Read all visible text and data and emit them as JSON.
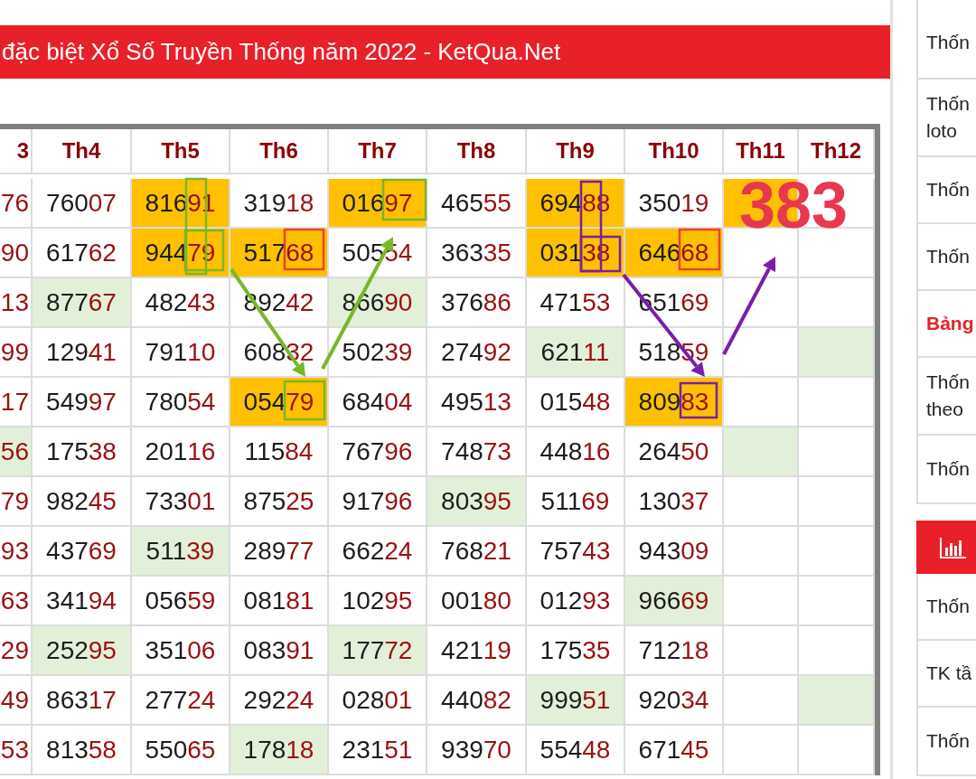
{
  "banner": {
    "title": "đặc biệt Xổ Số Truyền Thống năm 2022 - KetQua.Net"
  },
  "table": {
    "columns": [
      "3",
      "Th4",
      "Th5",
      "Th6",
      "Th7",
      "Th8",
      "Th9",
      "Th10",
      "Th11",
      "Th12"
    ],
    "rows": [
      {
        "cells": [
          {
            "value": "76",
            "kind": "plain"
          },
          {
            "value": "76007",
            "kind": "plain"
          },
          {
            "value": "81691",
            "kind": "gold"
          },
          {
            "value": "31918",
            "kind": "plain"
          },
          {
            "value": "01697",
            "kind": "gold"
          },
          {
            "value": "46555",
            "kind": "plain"
          },
          {
            "value": "69488",
            "kind": "gold"
          },
          {
            "value": "35019",
            "kind": "plain"
          },
          {
            "kind": "gold"
          },
          {
            "kind": "plain"
          }
        ]
      },
      {
        "cells": [
          {
            "value": "90",
            "kind": "plain"
          },
          {
            "value": "61762",
            "kind": "plain"
          },
          {
            "value": "94479",
            "kind": "gold"
          },
          {
            "value": "51768",
            "kind": "gold"
          },
          {
            "value": "50554",
            "kind": "plain"
          },
          {
            "value": "36335",
            "kind": "plain"
          },
          {
            "value": "03138",
            "kind": "gold"
          },
          {
            "value": "64668",
            "kind": "gold"
          },
          {
            "kind": "plain"
          },
          {
            "kind": "plain"
          }
        ]
      },
      {
        "cells": [
          {
            "value": "13",
            "kind": "plain"
          },
          {
            "value": "87767",
            "kind": "green"
          },
          {
            "value": "48243",
            "kind": "plain"
          },
          {
            "value": "89242",
            "kind": "plain"
          },
          {
            "value": "86690",
            "kind": "green"
          },
          {
            "value": "37686",
            "kind": "plain"
          },
          {
            "value": "47153",
            "kind": "plain"
          },
          {
            "value": "65169",
            "kind": "plain"
          },
          {
            "kind": "plain"
          },
          {
            "kind": "plain"
          }
        ]
      },
      {
        "cells": [
          {
            "value": "99",
            "kind": "plain"
          },
          {
            "value": "12941",
            "kind": "plain"
          },
          {
            "value": "79110",
            "kind": "plain"
          },
          {
            "value": "60832",
            "kind": "plain"
          },
          {
            "value": "50239",
            "kind": "plain"
          },
          {
            "value": "27492",
            "kind": "plain"
          },
          {
            "value": "62111",
            "kind": "green"
          },
          {
            "value": "51859",
            "kind": "plain"
          },
          {
            "kind": "plain"
          },
          {
            "kind": "green"
          }
        ]
      },
      {
        "cells": [
          {
            "value": "17",
            "kind": "plain"
          },
          {
            "value": "54997",
            "kind": "plain"
          },
          {
            "value": "78054",
            "kind": "plain"
          },
          {
            "value": "05479",
            "kind": "gold"
          },
          {
            "value": "68404",
            "kind": "plain"
          },
          {
            "value": "49513",
            "kind": "plain"
          },
          {
            "value": "01548",
            "kind": "plain"
          },
          {
            "value": "80983",
            "kind": "gold"
          },
          {
            "kind": "plain"
          },
          {
            "kind": "plain"
          }
        ]
      },
      {
        "cells": [
          {
            "value": "56",
            "kind": "green"
          },
          {
            "value": "17538",
            "kind": "plain"
          },
          {
            "value": "20116",
            "kind": "plain"
          },
          {
            "value": "11584",
            "kind": "plain"
          },
          {
            "value": "76796",
            "kind": "plain"
          },
          {
            "value": "74873",
            "kind": "plain"
          },
          {
            "value": "44816",
            "kind": "plain"
          },
          {
            "value": "26450",
            "kind": "plain"
          },
          {
            "kind": "green"
          },
          {
            "kind": "plain"
          }
        ]
      },
      {
        "cells": [
          {
            "value": "79",
            "kind": "plain"
          },
          {
            "value": "98245",
            "kind": "plain"
          },
          {
            "value": "73301",
            "kind": "plain"
          },
          {
            "value": "87525",
            "kind": "plain"
          },
          {
            "value": "91796",
            "kind": "plain"
          },
          {
            "value": "80395",
            "kind": "green"
          },
          {
            "value": "51169",
            "kind": "plain"
          },
          {
            "value": "13037",
            "kind": "plain"
          },
          {
            "kind": "plain"
          },
          {
            "kind": "plain"
          }
        ]
      },
      {
        "cells": [
          {
            "value": "93",
            "kind": "plain"
          },
          {
            "value": "43769",
            "kind": "plain"
          },
          {
            "value": "51139",
            "kind": "green"
          },
          {
            "value": "28977",
            "kind": "plain"
          },
          {
            "value": "66224",
            "kind": "plain"
          },
          {
            "value": "76821",
            "kind": "plain"
          },
          {
            "value": "75743",
            "kind": "plain"
          },
          {
            "value": "94309",
            "kind": "plain"
          },
          {
            "kind": "plain"
          },
          {
            "kind": "plain"
          }
        ]
      },
      {
        "cells": [
          {
            "value": "63",
            "kind": "plain"
          },
          {
            "value": "34194",
            "kind": "plain"
          },
          {
            "value": "05659",
            "kind": "plain"
          },
          {
            "value": "08181",
            "kind": "plain"
          },
          {
            "value": "10295",
            "kind": "plain"
          },
          {
            "value": "00180",
            "kind": "plain"
          },
          {
            "value": "01293",
            "kind": "plain"
          },
          {
            "value": "96669",
            "kind": "green"
          },
          {
            "kind": "plain"
          },
          {
            "kind": "plain"
          }
        ]
      },
      {
        "cells": [
          {
            "value": "29",
            "kind": "plain"
          },
          {
            "value": "25295",
            "kind": "green"
          },
          {
            "value": "35106",
            "kind": "plain"
          },
          {
            "value": "08391",
            "kind": "plain"
          },
          {
            "value": "17772",
            "kind": "green"
          },
          {
            "value": "42119",
            "kind": "plain"
          },
          {
            "value": "17535",
            "kind": "plain"
          },
          {
            "value": "71218",
            "kind": "plain"
          },
          {
            "kind": "plain"
          },
          {
            "kind": "plain"
          }
        ]
      },
      {
        "cells": [
          {
            "value": "49",
            "kind": "plain"
          },
          {
            "value": "86317",
            "kind": "plain"
          },
          {
            "value": "27724",
            "kind": "plain"
          },
          {
            "value": "29224",
            "kind": "plain"
          },
          {
            "value": "02801",
            "kind": "plain"
          },
          {
            "value": "44082",
            "kind": "plain"
          },
          {
            "value": "99951",
            "kind": "green"
          },
          {
            "value": "92034",
            "kind": "plain"
          },
          {
            "kind": "plain"
          },
          {
            "kind": "green"
          }
        ]
      },
      {
        "cells": [
          {
            "value": "53",
            "kind": "plain"
          },
          {
            "value": "81358",
            "kind": "plain"
          },
          {
            "value": "55065",
            "kind": "plain"
          },
          {
            "value": "17818",
            "kind": "green"
          },
          {
            "value": "23151",
            "kind": "plain"
          },
          {
            "value": "93970",
            "kind": "plain"
          },
          {
            "value": "55448",
            "kind": "plain"
          },
          {
            "value": "67145",
            "kind": "plain"
          },
          {
            "kind": "plain"
          },
          {
            "kind": "plain"
          }
        ]
      }
    ],
    "annotation": {
      "text": "383"
    }
  },
  "sidebar": {
    "sections": [
      {
        "items": [
          {
            "kind": "link",
            "label": "Thốn"
          },
          {
            "kind": "link",
            "label": "Thốn loto"
          },
          {
            "kind": "link",
            "label": "Thốn"
          },
          {
            "kind": "link",
            "label": "Thốn"
          },
          {
            "kind": "heading",
            "label": "Bảng"
          },
          {
            "kind": "link",
            "label": "Thốn theo"
          },
          {
            "kind": "link",
            "label": "Thốn"
          }
        ]
      },
      {
        "items": [
          {
            "kind": "link",
            "label": "Thốn"
          },
          {
            "kind": "link",
            "label": "TK tầ"
          },
          {
            "kind": "link",
            "label": "Thốn"
          }
        ]
      }
    ]
  }
}
